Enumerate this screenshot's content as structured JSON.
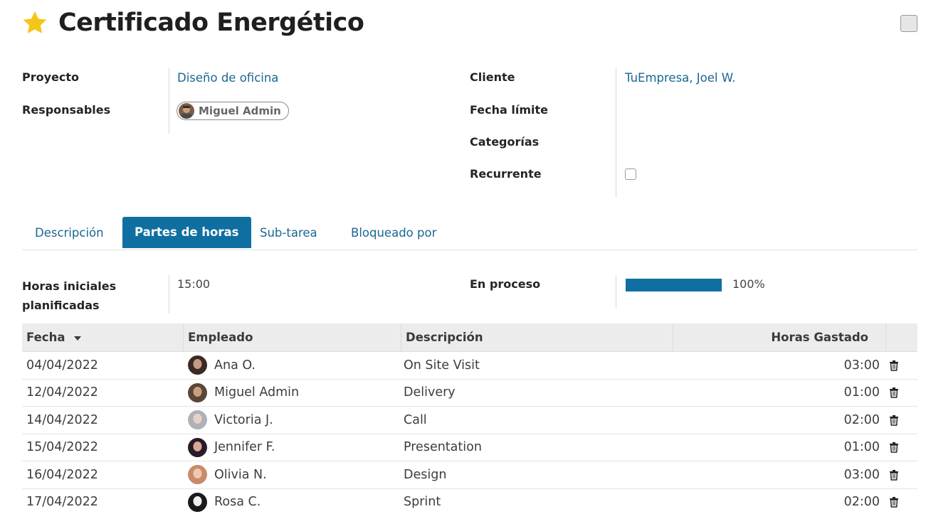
{
  "header": {
    "title": "Certificado Energético"
  },
  "fields": {
    "project_label": "Proyecto",
    "project_value": "Diseño de oficina",
    "assignees_label": "Responsables",
    "assignee_name": "Miguel Admin",
    "customer_label": "Cliente",
    "customer_value": "TuEmpresa, Joel W.",
    "deadline_label": "Fecha límite",
    "tags_label": "Categorías",
    "recurrent_label": "Recurrente"
  },
  "tabs": [
    {
      "label": "Descripción",
      "active": false
    },
    {
      "label": "Partes de horas",
      "active": true
    },
    {
      "label": "Sub-tarea",
      "active": false
    },
    {
      "label": "Bloqueado por",
      "active": false
    }
  ],
  "timesheet": {
    "planned_label_line1": "Horas iniciales",
    "planned_label_line2": "planificadas",
    "planned_value": "15:00",
    "progress_label": "En proceso",
    "progress_value": 100,
    "progress_text": "100%",
    "columns": {
      "date": "Fecha",
      "employee": "Empleado",
      "description": "Descripción",
      "hours": "Horas Gastado"
    },
    "rows": [
      {
        "date": "04/04/2022",
        "employee": "Ana O.",
        "description": "On Site Visit",
        "hours": "03:00"
      },
      {
        "date": "12/04/2022",
        "employee": "Miguel Admin",
        "description": "Delivery",
        "hours": "01:00"
      },
      {
        "date": "14/04/2022",
        "employee": "Victoria J.",
        "description": "Call",
        "hours": "02:00"
      },
      {
        "date": "15/04/2022",
        "employee": "Jennifer F.",
        "description": "Presentation",
        "hours": "01:00"
      },
      {
        "date": "16/04/2022",
        "employee": "Olivia N.",
        "description": "Design",
        "hours": "03:00"
      },
      {
        "date": "17/04/2022",
        "employee": "Rosa C.",
        "description": "Sprint",
        "hours": "02:00"
      }
    ]
  },
  "colors": {
    "accent": "#0f6fa1",
    "link": "#1a6693",
    "star": "#f5c518"
  }
}
